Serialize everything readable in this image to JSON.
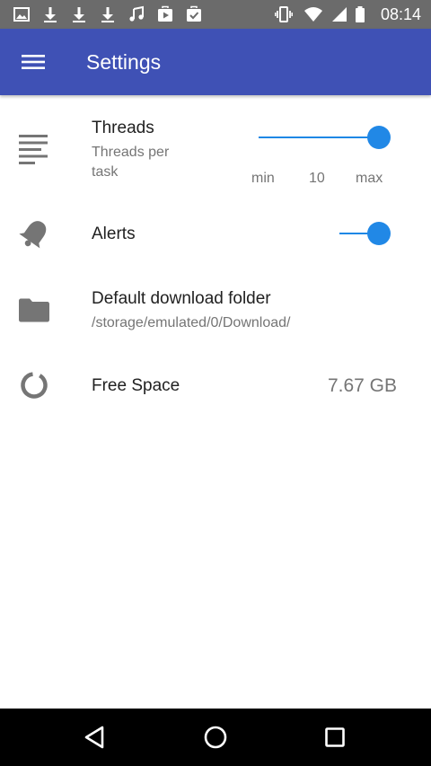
{
  "status_bar": {
    "time": "08:14",
    "left_icons": [
      "image-icon",
      "download-icon",
      "download-icon",
      "download-icon",
      "music-note-icon",
      "play-store-icon",
      "bag-check-icon"
    ],
    "right_icons": [
      "vibrate-icon",
      "wifi-icon",
      "signal-icon",
      "battery-icon"
    ]
  },
  "app_bar": {
    "title": "Settings",
    "color": "#3f51b5"
  },
  "settings": {
    "threads": {
      "title": "Threads",
      "subtitle": "Threads per task",
      "slider_min_label": "min",
      "slider_value": "10",
      "slider_max_label": "max",
      "slider_level": 1.0
    },
    "alerts": {
      "title": "Alerts",
      "enabled": true
    },
    "download_folder": {
      "title": "Default download folder",
      "path": "/storage/emulated/0/Download/"
    },
    "free_space": {
      "title": "Free Space",
      "value": "7.67 GB"
    }
  },
  "colors": {
    "accent": "#2188e6",
    "icon_gray": "#757575"
  }
}
